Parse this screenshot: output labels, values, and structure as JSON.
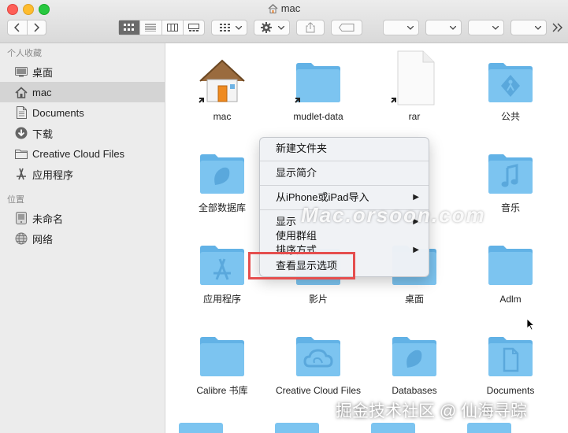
{
  "window": {
    "title": "mac"
  },
  "sidebar": {
    "section_favorites": "个人收藏",
    "favorites": [
      {
        "label": "桌面",
        "icon": "desktop-icon"
      },
      {
        "label": "mac",
        "icon": "home-icon"
      },
      {
        "label": "Documents",
        "icon": "document-icon"
      },
      {
        "label": "下载",
        "icon": "download-icon"
      },
      {
        "label": "Creative Cloud Files",
        "icon": "folder-icon"
      },
      {
        "label": "应用程序",
        "icon": "applications-icon"
      }
    ],
    "section_locations": "位置",
    "locations": [
      {
        "label": "未命名",
        "icon": "disk-icon"
      },
      {
        "label": "网络",
        "icon": "network-icon"
      }
    ]
  },
  "files": [
    {
      "label": "mac",
      "icon": "home-folder-icon"
    },
    {
      "label": "mudlet-data",
      "icon": "folder-icon"
    },
    {
      "label": "rar",
      "icon": "file-icon"
    },
    {
      "label": "公共",
      "icon": "public-folder-icon"
    },
    {
      "label": "全部数据库",
      "icon": "folder-icon"
    },
    {
      "label": "音乐",
      "icon": "music-folder-icon"
    },
    {
      "label": "应用程序",
      "icon": "applications-folder-icon"
    },
    {
      "label": "影片",
      "icon": "folder-icon"
    },
    {
      "label": "桌面",
      "icon": "folder-icon"
    },
    {
      "label": "Adlm",
      "icon": "folder-icon"
    },
    {
      "label": "Calibre 书库",
      "icon": "folder-icon"
    },
    {
      "label": "Creative Cloud Files",
      "icon": "creative-cloud-folder-icon"
    },
    {
      "label": "Databases",
      "icon": "folder-icon"
    },
    {
      "label": "Documents",
      "icon": "documents-folder-icon"
    }
  ],
  "context_menu": {
    "items": [
      "新建文件夹",
      "显示简介",
      "从iPhone或iPad导入",
      "显示",
      "使用群组",
      "排序方式",
      "查看显示选项"
    ]
  },
  "watermarks": {
    "site": "Mac.orsoon.com",
    "credit": "掘金技术社区 @ 仙海寻踪"
  },
  "colors": {
    "folder": "#7cc4f0",
    "folder_tab": "#62b2e6",
    "highlight": "#e54e4e"
  }
}
